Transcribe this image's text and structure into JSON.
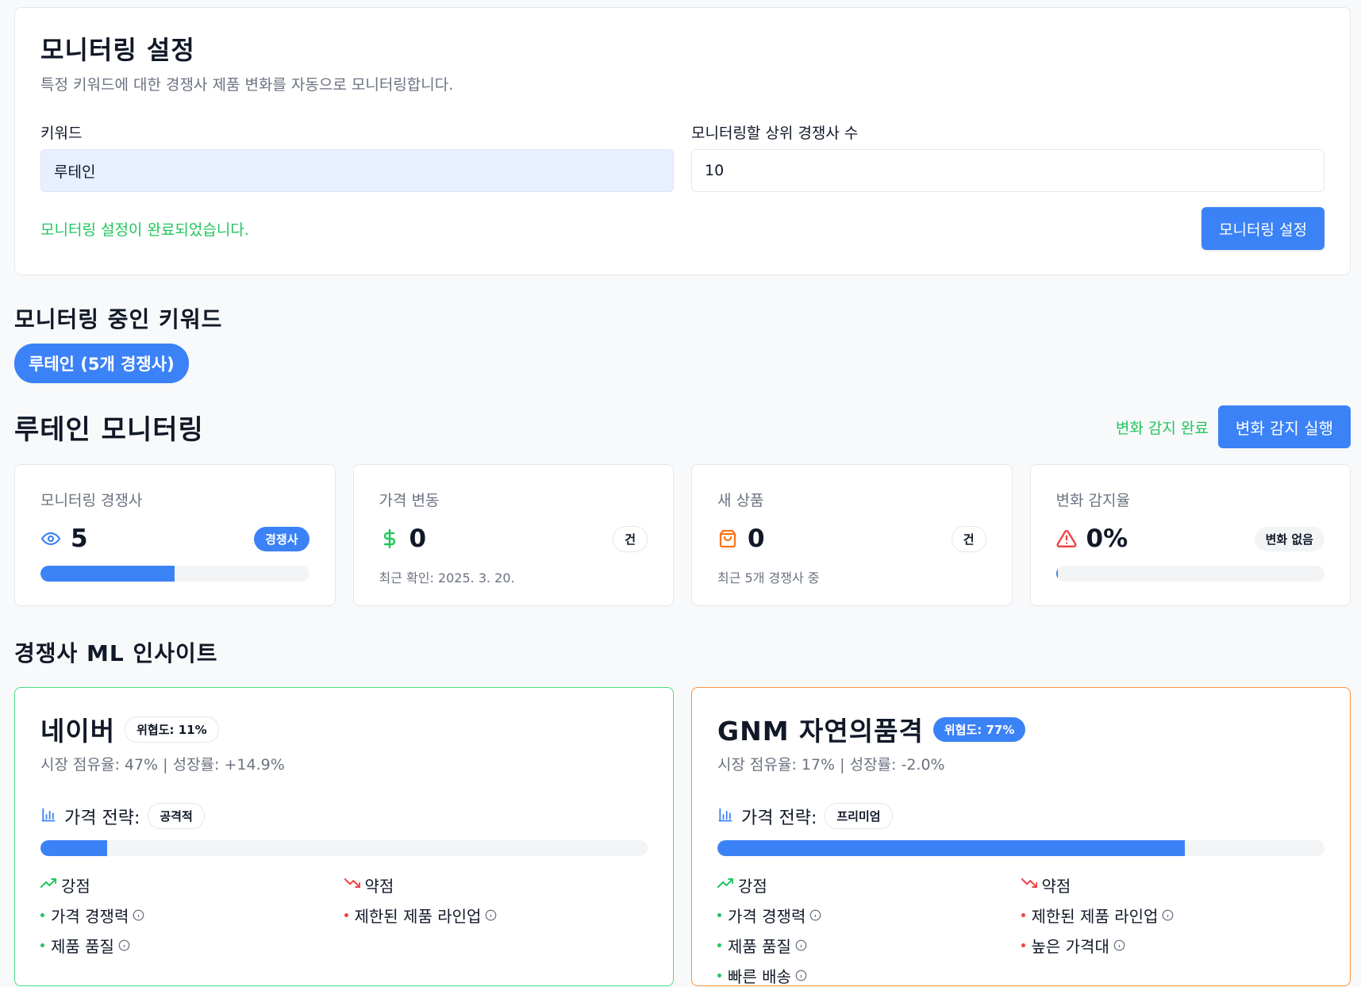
{
  "settings": {
    "title": "모니터링 설정",
    "description": "특정 키워드에 대한 경쟁사 제품 변화를 자동으로 모니터링합니다.",
    "keyword_label": "키워드",
    "keyword_value": "루테인",
    "competitors_label": "모니터링할 상위 경쟁사 수",
    "competitors_value": "10",
    "success_message": "모니터링 설정이 완료되었습니다.",
    "submit_label": "모니터링 설정"
  },
  "active": {
    "title": "모니터링 중인 키워드",
    "keyword_pill": "루테인 (5개 경쟁사)"
  },
  "monitor": {
    "title": "루테인 모니터링",
    "status": "변화 감지 완료",
    "run_label": "변화 감지 실행"
  },
  "stats": {
    "competitors": {
      "label": "모니터링 경쟁사",
      "value": "5",
      "badge": "경쟁사",
      "progress": 0.5
    },
    "price": {
      "label": "가격 변동",
      "value": "0",
      "badge": "건",
      "sub": "최근 확인: 2025. 3. 20."
    },
    "products": {
      "label": "새 상품",
      "value": "0",
      "badge": "건",
      "sub": "최근 5개 경쟁사 중"
    },
    "rate": {
      "label": "변화 감지율",
      "value": "0%",
      "badge": "변화 없음",
      "progress": 0.0
    }
  },
  "ml": {
    "title": "경쟁사 ML 인사이트",
    "strategy_prefix": "가격 전략:",
    "strengths_label": "강점",
    "weaknesses_label": "약점",
    "cards": [
      {
        "name": "네이버",
        "threat": "위협도: 11%",
        "meta": "시장 점유율: 47% | 성장률: +14.9%",
        "strategy": "공격적",
        "strategy_level": 0.11,
        "strengths": [
          "가격 경쟁력",
          "제품 품질"
        ],
        "weaknesses": [
          "제한된 제품 라인업"
        ]
      },
      {
        "name": "GNM 자연의품격",
        "threat": "위협도: 77%",
        "meta": "시장 점유율: 17% | 성장률: -2.0%",
        "strategy": "프리미엄",
        "strategy_level": 0.77,
        "strengths": [
          "가격 경쟁력",
          "제품 품질",
          "빠른 배송"
        ],
        "weaknesses": [
          "제한된 제품 라인업",
          "높은 가격대"
        ]
      }
    ]
  },
  "colors": {
    "accent": "#3b82f6",
    "success": "#22c55e",
    "danger": "#ef4444",
    "warning": "#f97316",
    "low_threat_border": "#4ade80",
    "high_threat_border": "#fb923c"
  },
  "icons": {
    "competitors": "eye-icon",
    "price": "dollar-icon",
    "products": "shopping-bag-icon",
    "rate": "alert-triangle-icon",
    "strategy": "bar-chart-icon",
    "strengths": "trending-up-icon",
    "weaknesses": "trending-down-icon",
    "info": "info-icon"
  }
}
